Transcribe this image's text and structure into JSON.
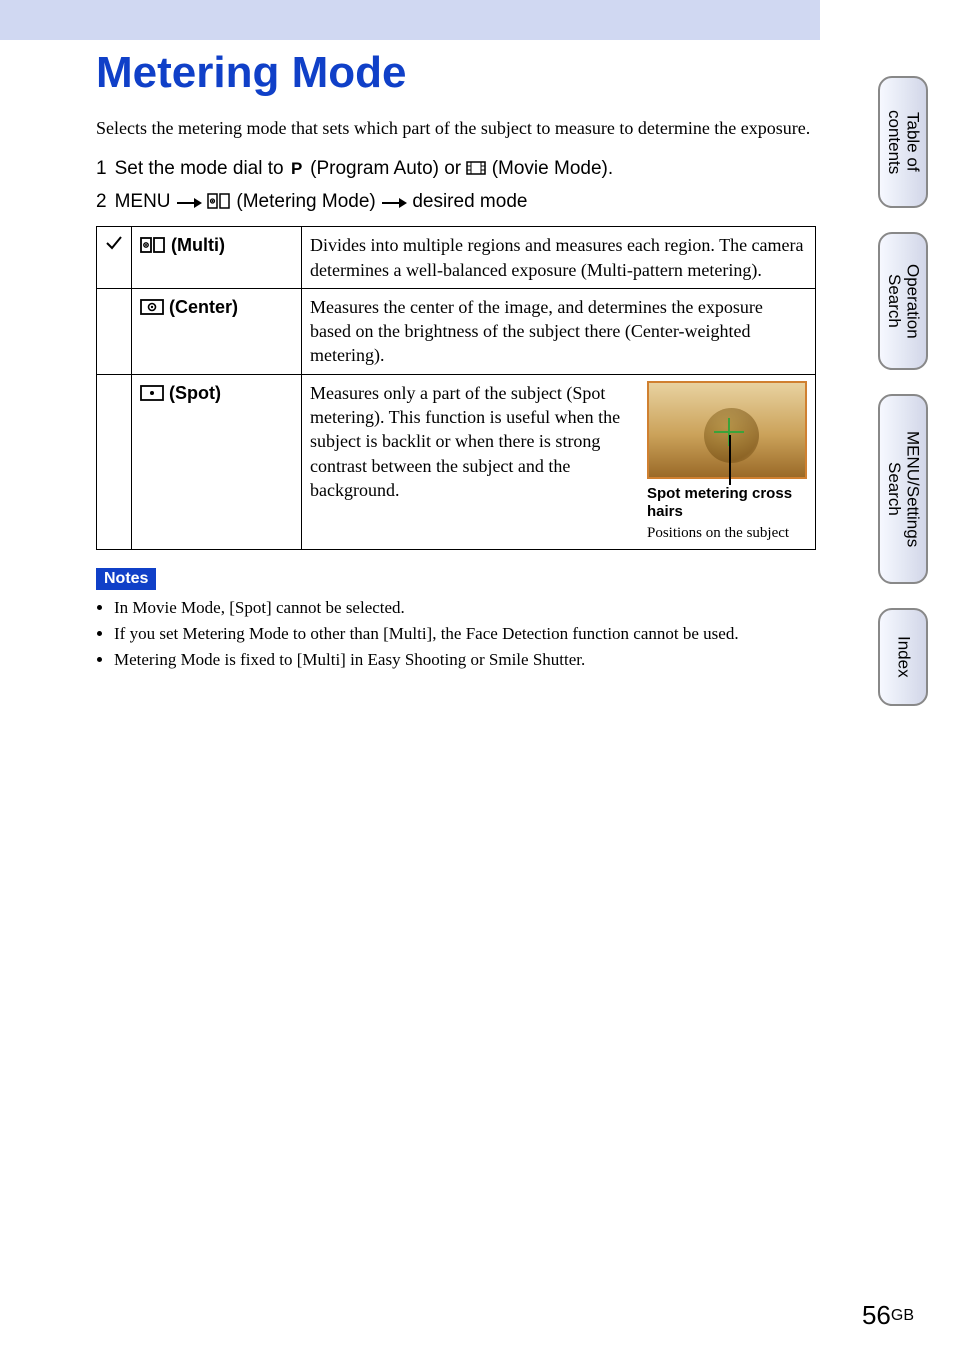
{
  "title": "Metering Mode",
  "intro": "Selects the metering mode that sets which part of the subject to measure to determine the exposure.",
  "steps": {
    "s1_num": "1",
    "s1_a": "Set the mode dial to ",
    "s1_b": " (Program Auto) or ",
    "s1_c": " (Movie Mode).",
    "s2_num": "2",
    "s2_a": "MENU ",
    "s2_b": " (Metering Mode) ",
    "s2_c": " desired mode"
  },
  "table": {
    "multi_label": " (Multi)",
    "multi_desc": "Divides into multiple regions and measures each region. The camera determines a well-balanced exposure (Multi-pattern metering).",
    "center_label": " (Center)",
    "center_desc": "Measures the center of the image, and determines the exposure based on the brightness of the subject there (Center-weighted metering).",
    "spot_label": " (Spot)",
    "spot_desc": "Measures only a part of the subject (Spot metering). This function is useful when the subject is backlit or when there is strong contrast between the subject and the background.",
    "spot_caption1": "Spot metering cross hairs",
    "spot_caption2": "Positions on the subject"
  },
  "notes_heading": "Notes",
  "notes": {
    "n1": "In Movie Mode, [Spot] cannot be selected.",
    "n2": "If you set Metering Mode to other than [Multi], the Face Detection function cannot be used.",
    "n3": "Metering Mode is fixed to [Multi] in Easy Shooting or Smile Shutter."
  },
  "tabs": {
    "t1": "Table of contents",
    "t2": "Operation Search",
    "t3": "MENU/Settings Search",
    "t4": "Index"
  },
  "page": {
    "num": "56",
    "suffix": "GB"
  }
}
